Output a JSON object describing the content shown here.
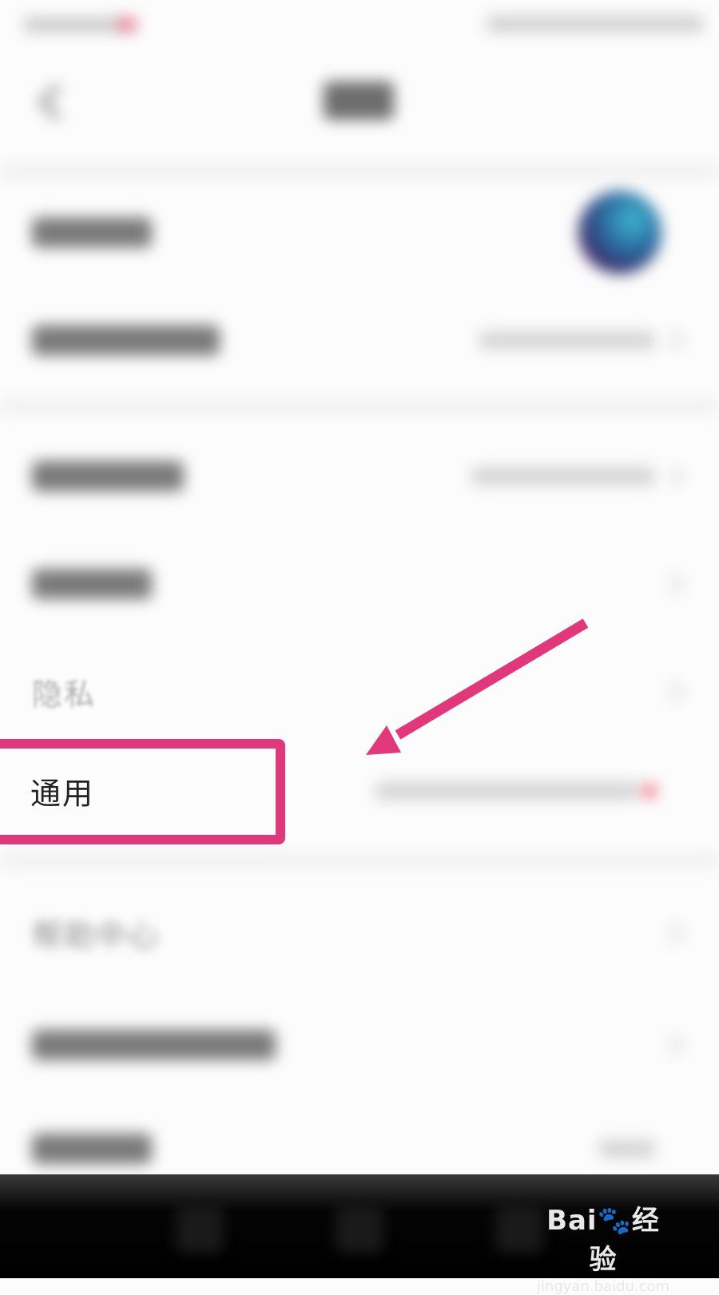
{
  "rows": {
    "privacy_label": "隐私",
    "general_label": "通用",
    "help_label": "帮助中心"
  },
  "colors": {
    "highlight": "#e0387a",
    "background": "#fcfcfc"
  },
  "watermark": {
    "logo": "Bai🐾经验",
    "url": "jingyan.baidu.com"
  }
}
